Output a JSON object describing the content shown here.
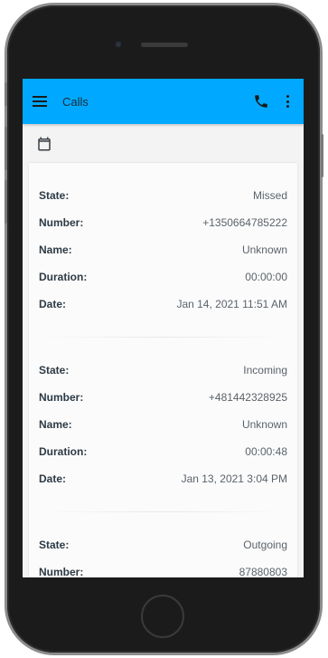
{
  "app": {
    "title": "Calls"
  },
  "icons": {
    "menu": "menu-icon",
    "phone": "phone-icon",
    "more": "more-vertical-icon",
    "calendar": "calendar-icon"
  },
  "colors": {
    "appbar": "#00a9ff",
    "background": "#f3f3f3"
  },
  "labels": {
    "state": "State:",
    "number": "Number:",
    "name": "Name:",
    "duration": "Duration:",
    "date": "Date:"
  },
  "calls": [
    {
      "state": "Missed",
      "number": "+1350664785222",
      "name": "Unknown",
      "duration": "00:00:00",
      "date": "Jan 14, 2021 11:51 AM"
    },
    {
      "state": "Incoming",
      "number": "+481442328925",
      "name": "Unknown",
      "duration": "00:00:48",
      "date": "Jan 13, 2021 3:04 PM"
    },
    {
      "state": "Outgoing",
      "number": "87880803"
    }
  ]
}
